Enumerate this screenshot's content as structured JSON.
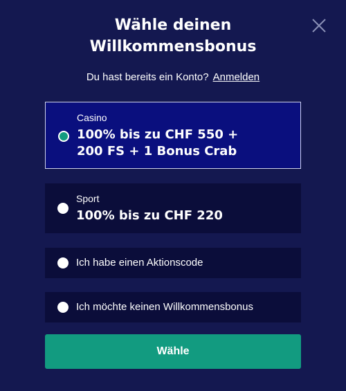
{
  "header": {
    "title_line1": "Wähle deinen",
    "title_line2": "Willkommensbonus",
    "close_icon": "close-icon"
  },
  "login": {
    "prompt": "Du hast bereits ein Konto?",
    "link_label": "Anmelden"
  },
  "options": [
    {
      "label": "Casino",
      "value_line1": "100% bis zu CHF 550 +",
      "value_line2": "200 FS + 1 Bonus Crab",
      "selected": true
    },
    {
      "label": "Sport",
      "value_line1": "100% bis zu CHF 220",
      "selected": false
    },
    {
      "text": "Ich habe einen Aktionscode",
      "selected": false
    },
    {
      "text": "Ich möchte keinen Willkommensbonus",
      "selected": false
    }
  ],
  "submit": {
    "label": "Wähle"
  },
  "colors": {
    "background": "#141850",
    "selected_option": "#0a0f7e",
    "option": "#0b0d3a",
    "accent": "#129b80"
  }
}
